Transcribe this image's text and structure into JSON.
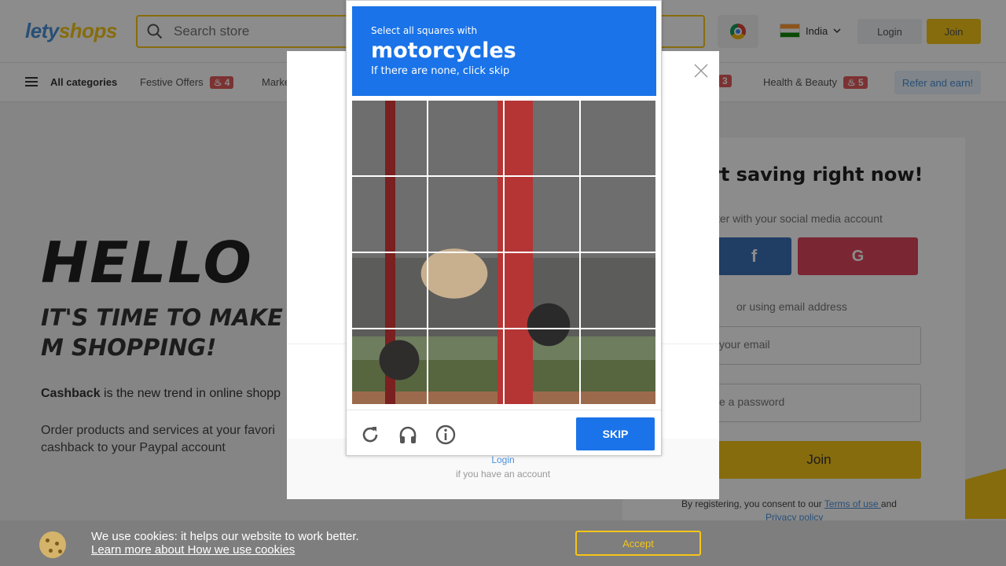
{
  "header": {
    "logo_a": "lety",
    "logo_b": "shops",
    "search_placeholder": "Search store",
    "country": "India",
    "login_label": "Login",
    "join_label": "Join"
  },
  "categories": {
    "all_label": "All categories",
    "festive": "Festive Offers",
    "festive_count": "4",
    "market": "Marke",
    "hidden_count": "3",
    "health": "Health & Beauty",
    "health_count": "5",
    "refer_label": "Refer and earn!"
  },
  "hero": {
    "title": "HELLO",
    "subtitle": "IT'S TIME TO MAKE M SHOPPING!",
    "p1_bold": "Cashback",
    "p1_rest": " is the new trend in online shopp",
    "p2": "Order products and services at your favori cashback to your Paypal account"
  },
  "register": {
    "title": "rt saving right now!",
    "social": "ter with your social media account",
    "fb": "f",
    "google": "G",
    "or_email": "or using email address",
    "email_placeholder": "your email",
    "password_placeholder": "e a password",
    "join_label": "Join",
    "consent_text": "By registering, you consent to our ",
    "terms": "Terms of use ",
    "and": "and",
    "privacy": "Privacy policy"
  },
  "modal": {
    "login_link": "Login",
    "hint": "if you have an account"
  },
  "cookie": {
    "line1": "We use cookies: it helps our website to work better.",
    "line2": "Learn more about How we use cookies",
    "accept": "Accept"
  },
  "captcha": {
    "line1": "Select all squares with",
    "target": "motorcycles",
    "line3": "If there are none, click skip",
    "skip_label": "SKIP",
    "icons": [
      "reload-icon",
      "audio-icon",
      "info-icon"
    ],
    "grid_size": 4,
    "accent": "#1a73e8"
  }
}
